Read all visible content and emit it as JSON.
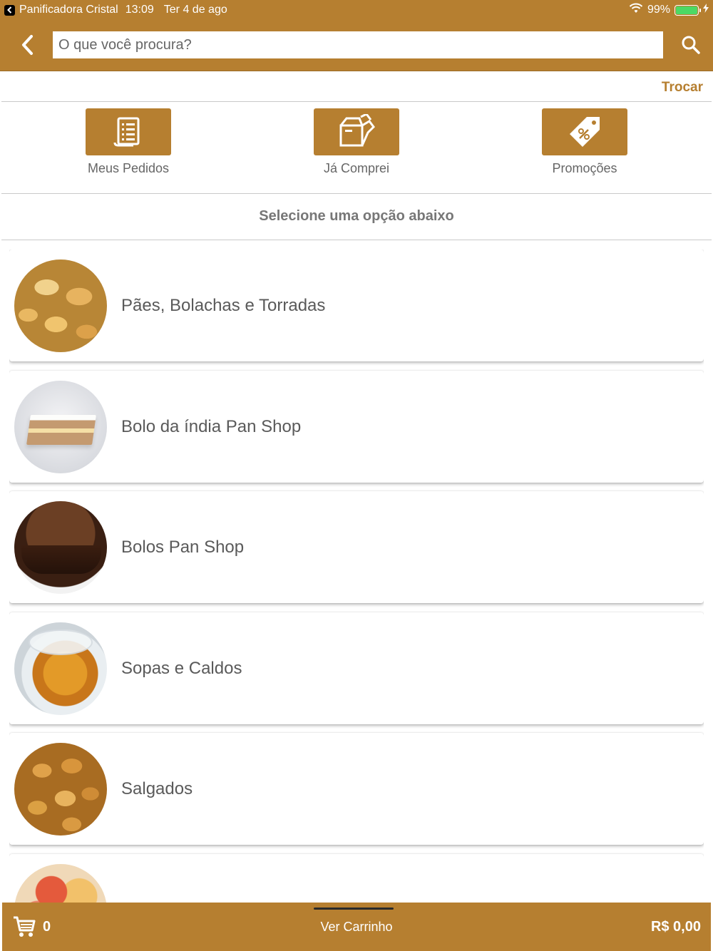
{
  "status_bar": {
    "app_name": "Panificadora Cristal",
    "time": "13:09",
    "date": "Ter 4 de ago",
    "battery": "99%",
    "battery_level": 0.99
  },
  "header": {
    "search_placeholder": "O que você procura?"
  },
  "store": {
    "change_label": "Trocar"
  },
  "quick_actions": [
    {
      "label": "Meus Pedidos",
      "icon": "receipt-icon"
    },
    {
      "label": "Já Comprei",
      "icon": "open-box-icon"
    },
    {
      "label": "Promoções",
      "icon": "discount-tag-icon"
    }
  ],
  "section_title": "Selecione uma opção abaixo",
  "categories": [
    {
      "label": "Pães, Bolachas e Torradas",
      "image": "bread"
    },
    {
      "label": "Bolo da índia Pan Shop",
      "image": "cake-slice"
    },
    {
      "label": "Bolos Pan Shop",
      "image": "chocolate-cake"
    },
    {
      "label": "Sopas e Caldos",
      "image": "soup-containers"
    },
    {
      "label": "Salgados",
      "image": "savory-snacks"
    },
    {
      "label": "",
      "image": "cold-cuts"
    }
  ],
  "cart": {
    "count": "0",
    "label": "Ver Carrinho",
    "total": "R$ 0,00"
  },
  "colors": {
    "brand": "#B67F30",
    "battery_green": "#4cd964"
  }
}
